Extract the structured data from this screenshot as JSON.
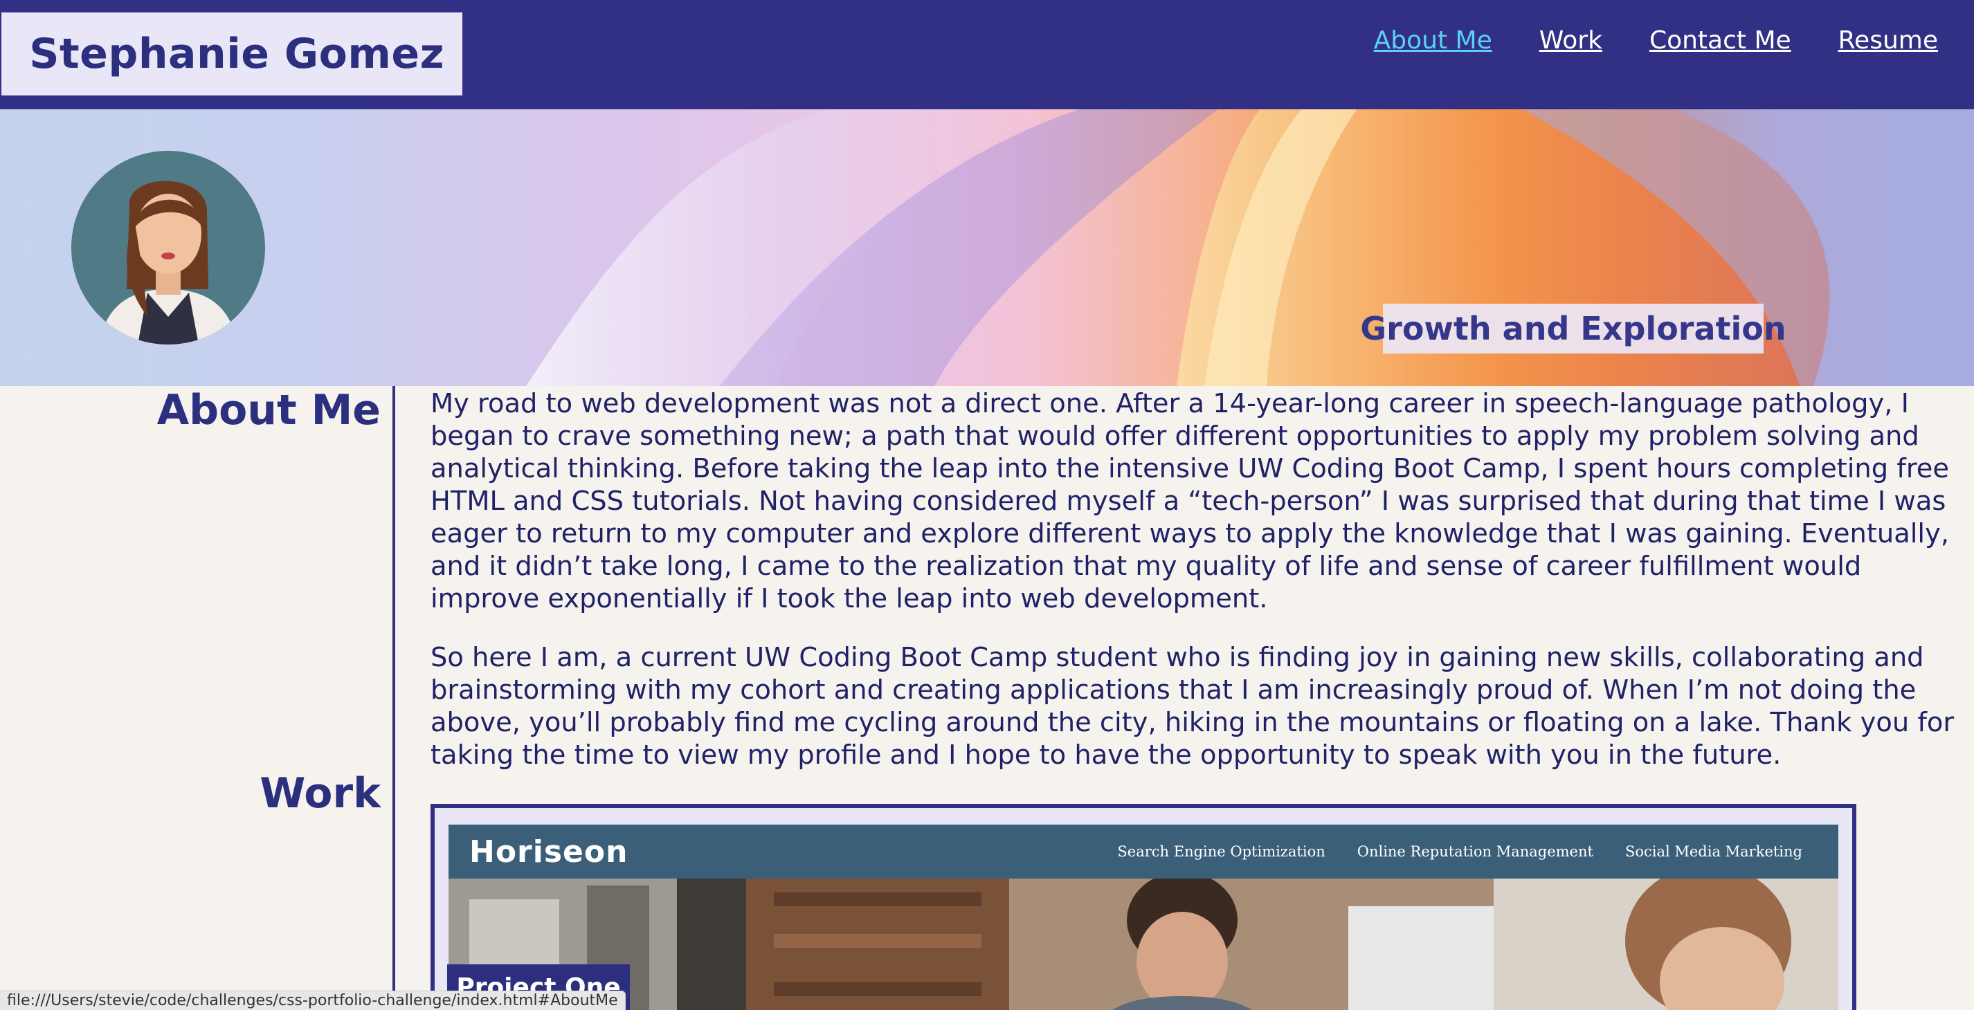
{
  "header": {
    "name": "Stephanie Gomez",
    "nav": [
      {
        "label": "About Me",
        "active": true
      },
      {
        "label": "Work",
        "active": false
      },
      {
        "label": "Contact Me",
        "active": false
      },
      {
        "label": "Resume",
        "active": false
      }
    ]
  },
  "hero": {
    "tagline": "Growth and Exploration",
    "avatar": "woman-avatar-icon"
  },
  "about": {
    "heading": "About Me",
    "paragraphs": [
      "My road to web development was not a direct one. After a 14-year-long career in speech-language pathology, I began to crave something new; a path that would offer different opportunities to apply my problem solving and analytical thinking. Before taking the leap into the intensive UW Coding Boot Camp, I spent hours completing free HTML and CSS tutorials. Not having considered myself a “tech-person” I was surprised that during that time I was eager to return to my computer and explore different ways to apply the knowledge that I was gaining. Eventually, and it didn’t take long, I came to the realization that my quality of life and sense of career fulfillment would improve exponentially if I took the leap into web development.",
      "So here I am, a current UW Coding Boot Camp student who is finding joy in gaining new skills, collaborating and brainstorming with my cohort and creating applications that I am increasingly proud of. When I’m not doing the above, you’ll probably find me cycling around the city, hiking in the mountains or floating on a lake. Thank you for taking the time to view my profile and I hope to have the opportunity to speak with you in the future."
    ]
  },
  "work": {
    "heading": "Work",
    "project": {
      "label": "Project One",
      "screenshot": {
        "brand": "Horiseon",
        "links": [
          "Search Engine Optimization",
          "Online Reputation Management",
          "Social Media Marketing"
        ]
      }
    }
  },
  "status_bar": {
    "url": "file:///Users/stevie/code/challenges/css-portfolio-challenge/index.html#AboutMe"
  },
  "colors": {
    "header_bg": "#313085",
    "name_box_bg": "#e8e6f7",
    "text_primary": "#2b2f7e",
    "nav_link": "#ffffff",
    "nav_active": "#59d2f2",
    "page_bg": "#f6f3ef"
  }
}
